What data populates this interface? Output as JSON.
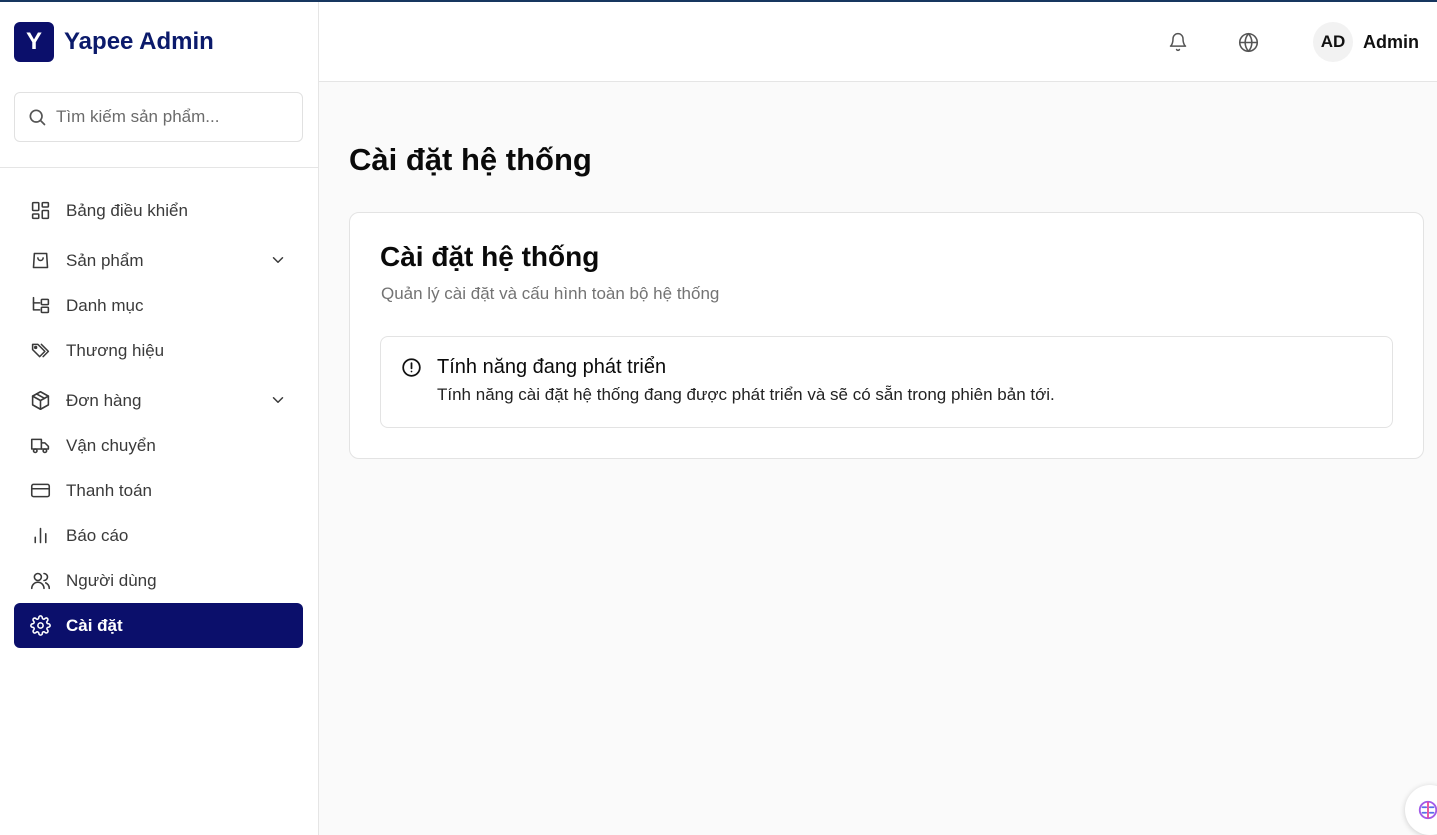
{
  "app": {
    "logo_letter": "Y",
    "name": "Yapee Admin"
  },
  "search": {
    "placeholder": "Tìm kiếm sản phẩm...",
    "value": ""
  },
  "sidebar": {
    "items": [
      {
        "label": "Bảng điều khiển",
        "icon": "dashboard-icon"
      },
      {
        "label": "Sản phẩm",
        "icon": "shopping-bag-icon",
        "expandable": true
      },
      {
        "label": "Danh mục",
        "icon": "category-tree-icon"
      },
      {
        "label": "Thương hiệu",
        "icon": "tags-icon"
      },
      {
        "label": "Đơn hàng",
        "icon": "package-icon",
        "expandable": true
      },
      {
        "label": "Vận chuyển",
        "icon": "truck-icon"
      },
      {
        "label": "Thanh toán",
        "icon": "credit-card-icon"
      },
      {
        "label": "Báo cáo",
        "icon": "bar-chart-icon"
      },
      {
        "label": "Người dùng",
        "icon": "users-icon"
      },
      {
        "label": "Cài đặt",
        "icon": "settings-gear-icon",
        "active": true
      }
    ]
  },
  "header": {
    "user_initials": "AD",
    "user_name": "Admin",
    "icons": [
      "bell-icon",
      "globe-icon"
    ]
  },
  "main": {
    "page_title": "Cài đặt hệ thống",
    "card": {
      "title": "Cài đặt hệ thống",
      "subtitle": "Quản lý cài đặt và cấu hình toàn bộ hệ thống",
      "alert": {
        "title": "Tính năng đang phát triển",
        "description": "Tính năng cài đặt hệ thống đang được phát triển và sẽ có sẵn trong phiên bản tới."
      }
    }
  },
  "colors": {
    "brand": "#0b0f6b",
    "accent_line": "#16365f",
    "muted": "#737373"
  }
}
